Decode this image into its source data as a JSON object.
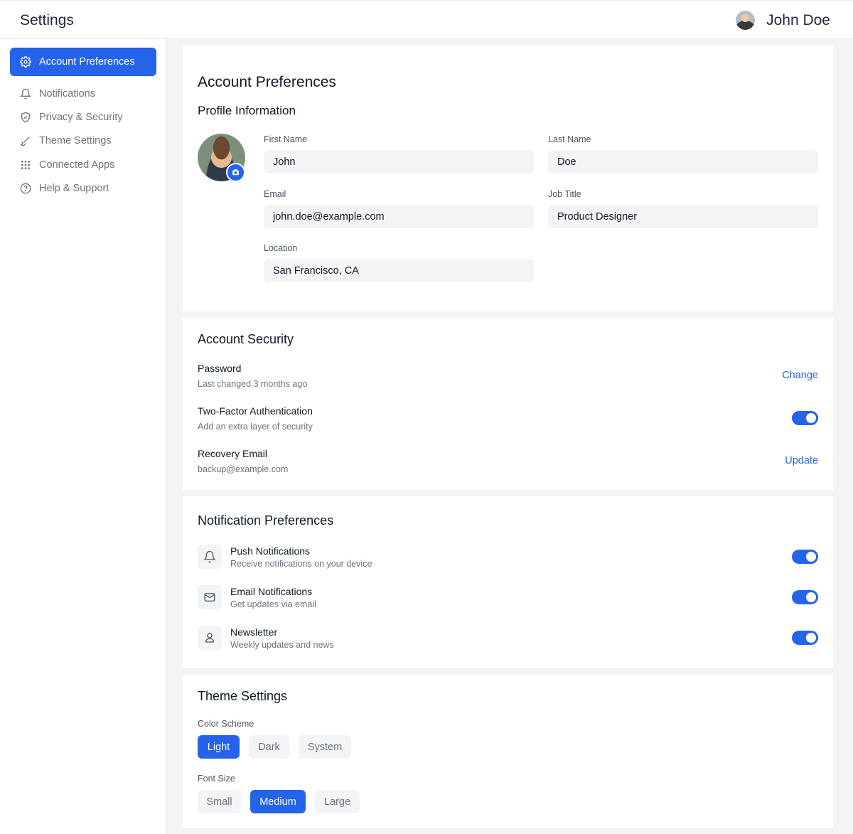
{
  "header": {
    "title": "Settings",
    "user_name": "John Doe"
  },
  "sidebar": {
    "items": [
      {
        "label": "Account Preferences",
        "icon": "gear-icon",
        "active": true
      },
      {
        "label": "Notifications",
        "icon": "bell-icon"
      },
      {
        "label": "Privacy & Security",
        "icon": "shield-icon"
      },
      {
        "label": "Theme Settings",
        "icon": "brush-icon"
      },
      {
        "label": "Connected Apps",
        "icon": "grid-icon"
      },
      {
        "label": "Help & Support",
        "icon": "help-icon"
      }
    ]
  },
  "account": {
    "title": "Account Preferences",
    "profile_title": "Profile Information",
    "fields": {
      "first_name": {
        "label": "First Name",
        "value": "John"
      },
      "last_name": {
        "label": "Last Name",
        "value": "Doe"
      },
      "email": {
        "label": "Email",
        "value": "john.doe@example.com"
      },
      "job_title": {
        "label": "Job Title",
        "value": "Product Designer"
      },
      "location": {
        "label": "Location",
        "value": "San Francisco, CA"
      }
    }
  },
  "security": {
    "title": "Account Security",
    "password": {
      "title": "Password",
      "sub": "Last changed 3 months ago",
      "action": "Change"
    },
    "two_factor": {
      "title": "Two-Factor Authentication",
      "sub": "Add an extra layer of security",
      "enabled": true
    },
    "recovery": {
      "title": "Recovery Email",
      "sub": "backup@example.com",
      "action": "Update"
    }
  },
  "notifications": {
    "title": "Notification Preferences",
    "items": [
      {
        "title": "Push Notifications",
        "sub": "Receive notifications on your device",
        "icon": "bell-icon",
        "enabled": true
      },
      {
        "title": "Email Notifications",
        "sub": "Get updates via email",
        "icon": "mail-icon",
        "enabled": true
      },
      {
        "title": "Newsletter",
        "sub": "Weekly updates and news",
        "icon": "user-icon",
        "enabled": true
      }
    ]
  },
  "theme": {
    "title": "Theme Settings",
    "color_scheme_label": "Color Scheme",
    "color_schemes": [
      "Light",
      "Dark",
      "System"
    ],
    "color_scheme_selected": "Light",
    "font_size_label": "Font Size",
    "font_sizes": [
      "Small",
      "Medium",
      "Large"
    ],
    "font_size_selected": "Medium"
  },
  "colors": {
    "accent": "#2563eb",
    "background": "#f3f4f6",
    "card": "#ffffff",
    "muted_text": "#6b7280"
  }
}
